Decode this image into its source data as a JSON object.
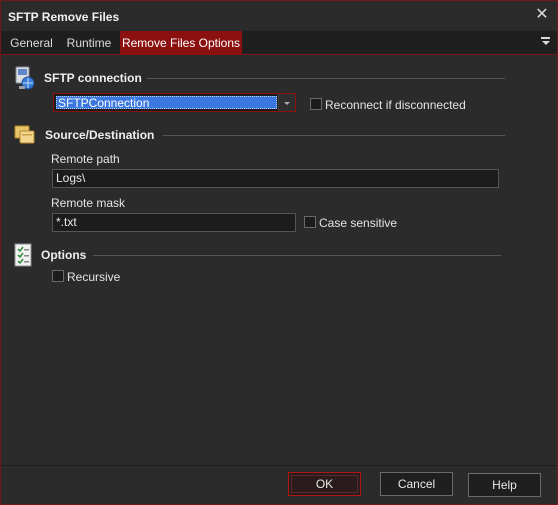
{
  "window": {
    "title": "SFTP Remove Files"
  },
  "tabs": [
    {
      "label": "General",
      "active": false
    },
    {
      "label": "Runtime",
      "active": false
    },
    {
      "label": "Remove Files Options",
      "active": true
    }
  ],
  "sections": {
    "sftp": {
      "title": "SFTP connection",
      "icon": "sftp-connection-icon",
      "connection_value": "SFTPConnection",
      "reconnect_label": "Reconnect if disconnected",
      "reconnect_checked": false
    },
    "source": {
      "title": "Source/Destination",
      "icon": "folders-icon",
      "remote_path_label": "Remote path",
      "remote_path_value": "Logs\\",
      "remote_mask_label": "Remote mask",
      "remote_mask_value": "*.txt",
      "case_sensitive_label": "Case sensitive",
      "case_sensitive_checked": false
    },
    "options": {
      "title": "Options",
      "icon": "checklist-icon",
      "recursive_label": "Recursive",
      "recursive_checked": false
    }
  },
  "buttons": {
    "ok": "OK",
    "cancel": "Cancel",
    "help": "Help"
  },
  "colors": {
    "accent": "#8b1010",
    "selection": "#3a78e0",
    "background": "#2b2b2b"
  }
}
